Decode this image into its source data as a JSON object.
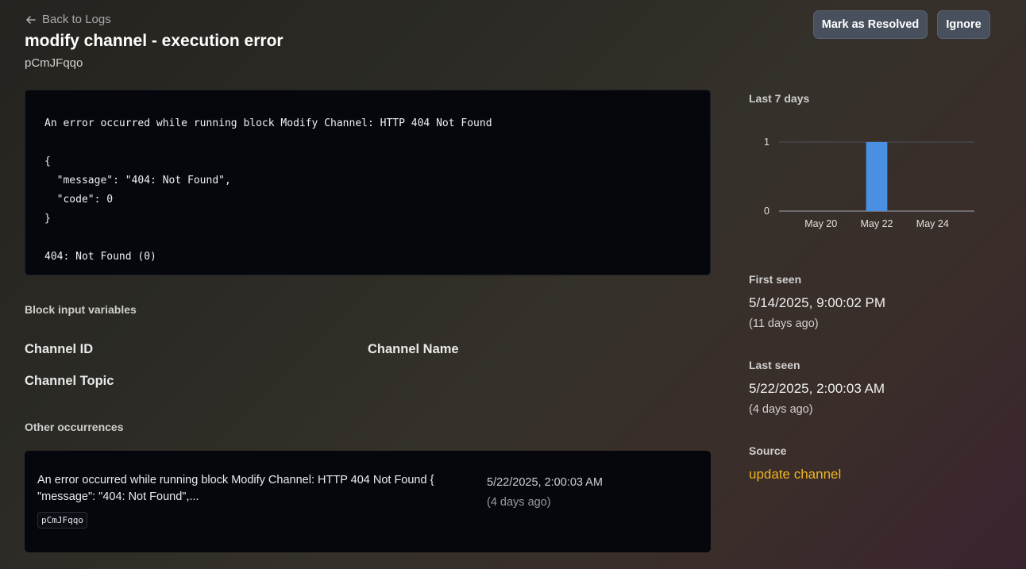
{
  "header": {
    "back_label": "Back to Logs",
    "title": "modify channel - execution error",
    "subtitle": "pCmJFqqo",
    "resolve_label": "Mark as Resolved",
    "ignore_label": "Ignore"
  },
  "error": {
    "text": "An error occurred while running block Modify Channel: HTTP 404 Not Found\n\n{\n  \"message\": \"404: Not Found\",\n  \"code\": 0\n}\n\n404: Not Found (0)"
  },
  "inputs": {
    "label": "Block input variables",
    "vars": [
      "Channel ID",
      "Channel Name",
      "Channel Topic"
    ]
  },
  "occurrences": {
    "label": "Other occurrences",
    "items": [
      {
        "message": "An error occurred while running block Modify Channel: HTTP 404 Not Found { \"message\": \"404: Not Found\",...",
        "tag": "pCmJFqqo",
        "date": "5/22/2025, 2:00:03 AM",
        "ago": "(4 days ago)"
      }
    ]
  },
  "sidebar": {
    "chart_label": "Last 7 days",
    "first_seen_label": "First seen",
    "first_seen_value": "5/14/2025, 9:00:02 PM",
    "first_seen_ago": "(11 days ago)",
    "last_seen_label": "Last seen",
    "last_seen_value": "5/22/2025, 2:00:03 AM",
    "last_seen_ago": "(4 days ago)",
    "source_label": "Source",
    "source_value": "update channel"
  },
  "colors": {
    "bar": "#4a90e2",
    "link": "#f0b420"
  },
  "chart_data": {
    "type": "bar",
    "categories": [
      "May 19",
      "May 20",
      "May 21",
      "May 22",
      "May 23",
      "May 24",
      "May 25"
    ],
    "values": [
      0,
      0,
      0,
      1,
      0,
      0,
      0
    ],
    "tick_labels": [
      "May 20",
      "May 22",
      "May 24"
    ],
    "y_ticks": [
      0,
      1
    ],
    "ylim": [
      0,
      1
    ],
    "title": "",
    "xlabel": "",
    "ylabel": "",
    "grid": true
  }
}
